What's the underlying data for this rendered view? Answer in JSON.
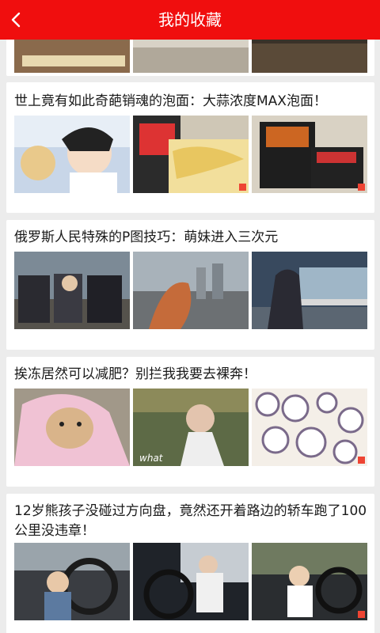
{
  "header": {
    "title": "我的收藏",
    "back_icon": "chevron-left-icon",
    "color": "#f00e0e"
  },
  "cards": [
    {
      "title": "",
      "thumbs": [
        {
          "alt": "partially visible anime frame"
        },
        {
          "alt": "partially visible frame"
        },
        {
          "alt": "partially visible frame"
        }
      ]
    },
    {
      "title": "世上竟有如此奇葩销魂的泡面：大蒜浓度MAX泡面！",
      "thumbs": [
        {
          "alt": "anime character shouting"
        },
        {
          "alt": "instant noodles with chopsticks"
        },
        {
          "alt": "instant noodle package"
        }
      ]
    },
    {
      "title": "俄罗斯人民特殊的P图技巧：萌妹进入三次元",
      "thumbs": [
        {
          "alt": "men with anime girl by car"
        },
        {
          "alt": "anime girl on balcony over city"
        },
        {
          "alt": "anime girl in subway station"
        }
      ]
    },
    {
      "title": "挨冻居然可以减肥？别拦我我要去裸奔！",
      "thumbs": [
        {
          "alt": "dog in pink hoodie"
        },
        {
          "alt": "man in costume",
          "caption": "what"
        },
        {
          "alt": "fat cells microscope"
        }
      ]
    },
    {
      "title": "12岁熊孩子没碰过方向盘，竟然还开着路边的轿车跑了100公里没违章！",
      "thumbs": [
        {
          "alt": "toddler at steering wheel"
        },
        {
          "alt": "child driving car"
        },
        {
          "alt": "toddler in driver seat"
        }
      ]
    }
  ]
}
